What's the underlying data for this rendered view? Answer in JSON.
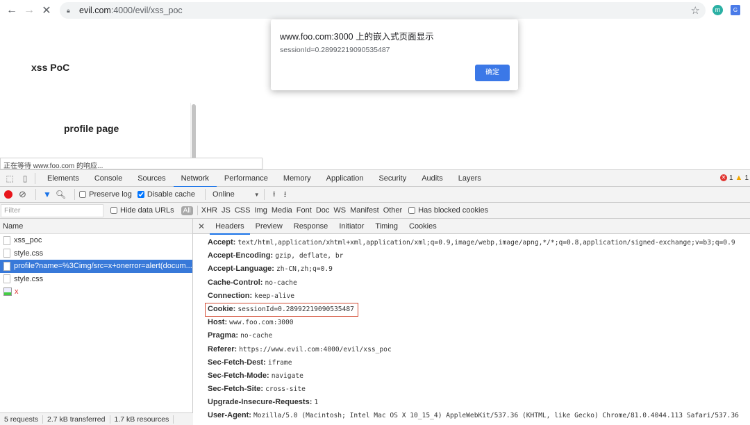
{
  "browser": {
    "url_host": "evil.com",
    "url_path": ":4000/evil/xss_poc",
    "ext1_label": "m",
    "ext2_label": "G"
  },
  "page": {
    "title": "xss PoC",
    "iframe_title": "profile page",
    "status_text": "正在等待 www.foo.com 的响应..."
  },
  "alert": {
    "title": "www.foo.com:3000 上的嵌入式页面显示",
    "message": "sessionId=0.28992219090535487",
    "ok_label": "确定"
  },
  "devtools": {
    "tabs": [
      "Elements",
      "Console",
      "Sources",
      "Network",
      "Performance",
      "Memory",
      "Application",
      "Security",
      "Audits",
      "Layers"
    ],
    "active_tab": "Network",
    "error_count": "1",
    "warning_count": "1",
    "toolbar": {
      "preserve_log": "Preserve log",
      "disable_cache": "Disable cache",
      "throttle": "Online"
    },
    "filter": {
      "placeholder": "Filter",
      "hide_data_urls": "Hide data URLs",
      "all": "All",
      "types": [
        "XHR",
        "JS",
        "CSS",
        "Img",
        "Media",
        "Font",
        "Doc",
        "WS",
        "Manifest",
        "Other"
      ],
      "blocked_cookies": "Has blocked cookies"
    },
    "requests": {
      "header": "Name",
      "items": [
        {
          "name": "xss_poc"
        },
        {
          "name": "style.css"
        },
        {
          "name": "profile?name=%3Cimg/src=x+onerror=alert(docum..."
        },
        {
          "name": "style.css"
        },
        {
          "name": "x"
        }
      ]
    },
    "summary": {
      "requests": "5 requests",
      "transferred": "2.7 kB transferred",
      "resources": "1.7 kB resources"
    },
    "detail_tabs": [
      "Headers",
      "Preview",
      "Response",
      "Initiator",
      "Timing",
      "Cookies"
    ],
    "active_detail_tab": "Headers",
    "headers": [
      {
        "key": "Accept:",
        "value": "text/html,application/xhtml+xml,application/xml;q=0.9,image/webp,image/apng,*/*;q=0.8,application/signed-exchange;v=b3;q=0.9"
      },
      {
        "key": "Accept-Encoding:",
        "value": "gzip, deflate, br"
      },
      {
        "key": "Accept-Language:",
        "value": "zh-CN,zh;q=0.9"
      },
      {
        "key": "Cache-Control:",
        "value": "no-cache"
      },
      {
        "key": "Connection:",
        "value": "keep-alive"
      },
      {
        "key": "Cookie:",
        "value": "sessionId=0.28992219090535487",
        "highlighted": true
      },
      {
        "key": "Host:",
        "value": "www.foo.com:3000"
      },
      {
        "key": "Pragma:",
        "value": "no-cache"
      },
      {
        "key": "Referer:",
        "value": "https://www.evil.com:4000/evil/xss_poc"
      },
      {
        "key": "Sec-Fetch-Dest:",
        "value": "iframe"
      },
      {
        "key": "Sec-Fetch-Mode:",
        "value": "navigate"
      },
      {
        "key": "Sec-Fetch-Site:",
        "value": "cross-site"
      },
      {
        "key": "Upgrade-Insecure-Requests:",
        "value": "1"
      },
      {
        "key": "User-Agent:",
        "value": "Mozilla/5.0 (Macintosh; Intel Mac OS X 10_15_4) AppleWebKit/537.36 (KHTML, like Gecko) Chrome/81.0.4044.113 Safari/537.36"
      }
    ]
  }
}
